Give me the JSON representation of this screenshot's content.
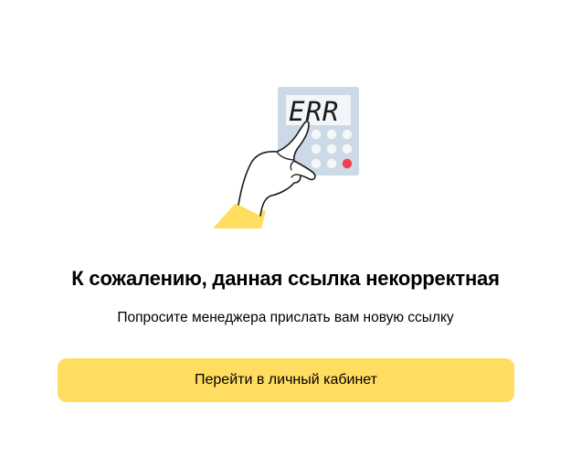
{
  "illustration": {
    "icon": "calculator-error-icon",
    "display_text": "ERR",
    "colors": {
      "calculator_body": "#cdd9e6",
      "calculator_screen": "#f2f5f9",
      "key": "#f5f7fa",
      "key_accent": "#f23d4f",
      "sleeve": "#ffdd60",
      "outline": "#1a1a1a"
    }
  },
  "title": "К сожалению, данная ссылка некорректная",
  "subtitle": "Попросите менеджера прислать вам новую ссылку",
  "button": {
    "label": "Перейти в личный кабинет",
    "color": "#ffdd60"
  }
}
